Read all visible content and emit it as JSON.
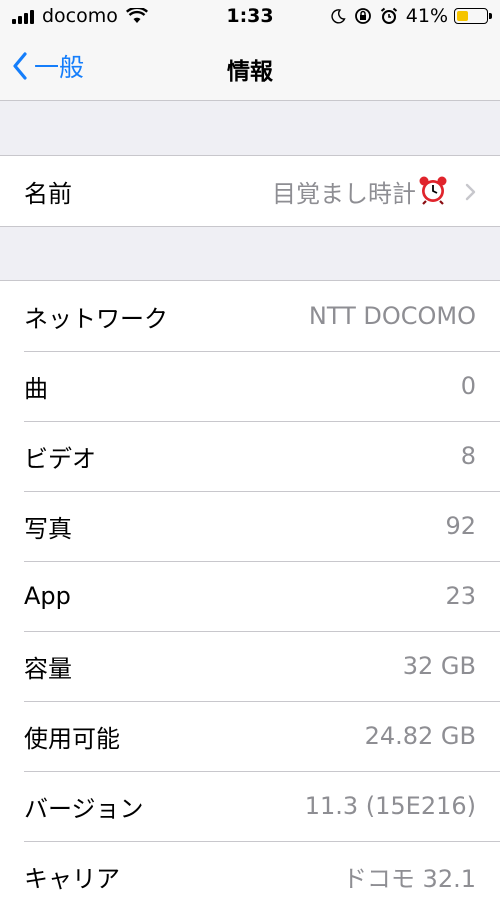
{
  "status_bar": {
    "carrier": "docomo",
    "time": "1:33",
    "battery_percent": "41%",
    "battery_level": 0.41,
    "battery_color": "#f5c400",
    "icons": [
      "signal-icon",
      "wifi-icon",
      "moon-icon",
      "rotation-lock-icon",
      "alarm-clock-icon",
      "battery-icon"
    ]
  },
  "nav": {
    "back_label": "一般",
    "title": "情報",
    "accent_color": "#157efb"
  },
  "name_row": {
    "label": "名前",
    "value": "目覚まし時計"
  },
  "info_rows": [
    {
      "label": "ネットワーク",
      "value": "NTT DOCOMO"
    },
    {
      "label": "曲",
      "value": "0"
    },
    {
      "label": "ビデオ",
      "value": "8"
    },
    {
      "label": "写真",
      "value": "92"
    },
    {
      "label": "App",
      "value": "23"
    },
    {
      "label": "容量",
      "value": "32 GB"
    },
    {
      "label": "使用可能",
      "value": "24.82 GB"
    },
    {
      "label": "バージョン",
      "value": "11.3 (15E216)"
    },
    {
      "label": "キャリア",
      "value": "ドコモ 32.1"
    }
  ]
}
